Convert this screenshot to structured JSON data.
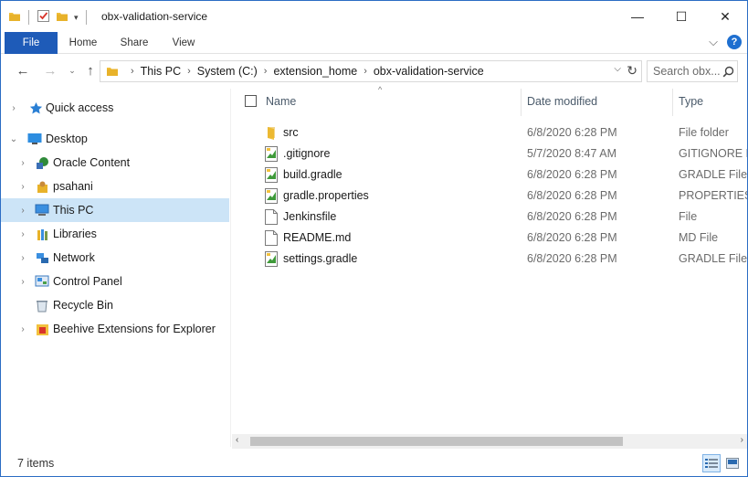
{
  "window": {
    "title": "obx-validation-service",
    "controls": {
      "minimize": "—",
      "maximize": "☐",
      "close": "✕"
    }
  },
  "ribbon": {
    "tabs": [
      "File",
      "Home",
      "Share",
      "View"
    ],
    "collapse_glyph": "⌵",
    "help_glyph": "?"
  },
  "address": {
    "back_glyph": "←",
    "forward_glyph": "→",
    "up_glyph": "↑",
    "crumbs": [
      "This PC",
      "System (C:)",
      "extension_home",
      "obx-validation-service"
    ],
    "separator": "›",
    "dropdown_glyph": "⌵",
    "refresh_glyph": "↻"
  },
  "search": {
    "placeholder": "Search obx...",
    "icon": "search-icon"
  },
  "nav_pane": {
    "items": [
      {
        "label": "Quick access",
        "icon": "star-icon",
        "chevron": "›",
        "selected": false
      },
      {
        "label": "Desktop",
        "icon": "desktop-icon",
        "chevron": "⌄",
        "selected": false
      },
      {
        "label": "Oracle Content",
        "icon": "oracle-content-icon",
        "chevron": "›",
        "selected": false
      },
      {
        "label": "psahani",
        "icon": "user-folder-icon",
        "chevron": "›",
        "selected": false
      },
      {
        "label": "This PC",
        "icon": "computer-icon",
        "chevron": "›",
        "selected": true
      },
      {
        "label": "Libraries",
        "icon": "libraries-icon",
        "chevron": "›",
        "selected": false
      },
      {
        "label": "Network",
        "icon": "network-icon",
        "chevron": "›",
        "selected": false
      },
      {
        "label": "Control Panel",
        "icon": "control-panel-icon",
        "chevron": "›",
        "selected": false
      },
      {
        "label": "Recycle Bin",
        "icon": "recycle-bin-icon",
        "chevron": "",
        "selected": false
      },
      {
        "label": "Beehive Extensions for Explorer",
        "icon": "beehive-icon",
        "chevron": "›",
        "selected": false
      }
    ]
  },
  "files": {
    "sort_glyph": "^",
    "columns": {
      "name": "Name",
      "date": "Date modified",
      "type": "Type"
    },
    "rows": [
      {
        "name": "src",
        "date": "6/8/2020 6:28 PM",
        "type": "File folder",
        "icon": "folder-icon"
      },
      {
        "name": ".gitignore",
        "date": "5/7/2020 8:47 AM",
        "type": "GITIGNORE Fi",
        "icon": "gradle-file-icon"
      },
      {
        "name": "build.gradle",
        "date": "6/8/2020 6:28 PM",
        "type": "GRADLE File",
        "icon": "gradle-file-icon"
      },
      {
        "name": "gradle.properties",
        "date": "6/8/2020 6:28 PM",
        "type": "PROPERTIES Fi",
        "icon": "gradle-file-icon"
      },
      {
        "name": "Jenkinsfile",
        "date": "6/8/2020 6:28 PM",
        "type": "File",
        "icon": "blank-file-icon"
      },
      {
        "name": "README.md",
        "date": "6/8/2020 6:28 PM",
        "type": "MD File",
        "icon": "blank-file-icon"
      },
      {
        "name": "settings.gradle",
        "date": "6/8/2020 6:28 PM",
        "type": "GRADLE File",
        "icon": "gradle-file-icon"
      }
    ]
  },
  "scrollbar": {
    "left_glyph": "‹",
    "right_glyph": "›"
  },
  "status": {
    "item_count": "7 items"
  },
  "colors": {
    "file_tab": "#1e5bb8",
    "selected": "#cce4f7",
    "folder": "#f2c13d",
    "gradle_green": "#3f9a3a"
  }
}
